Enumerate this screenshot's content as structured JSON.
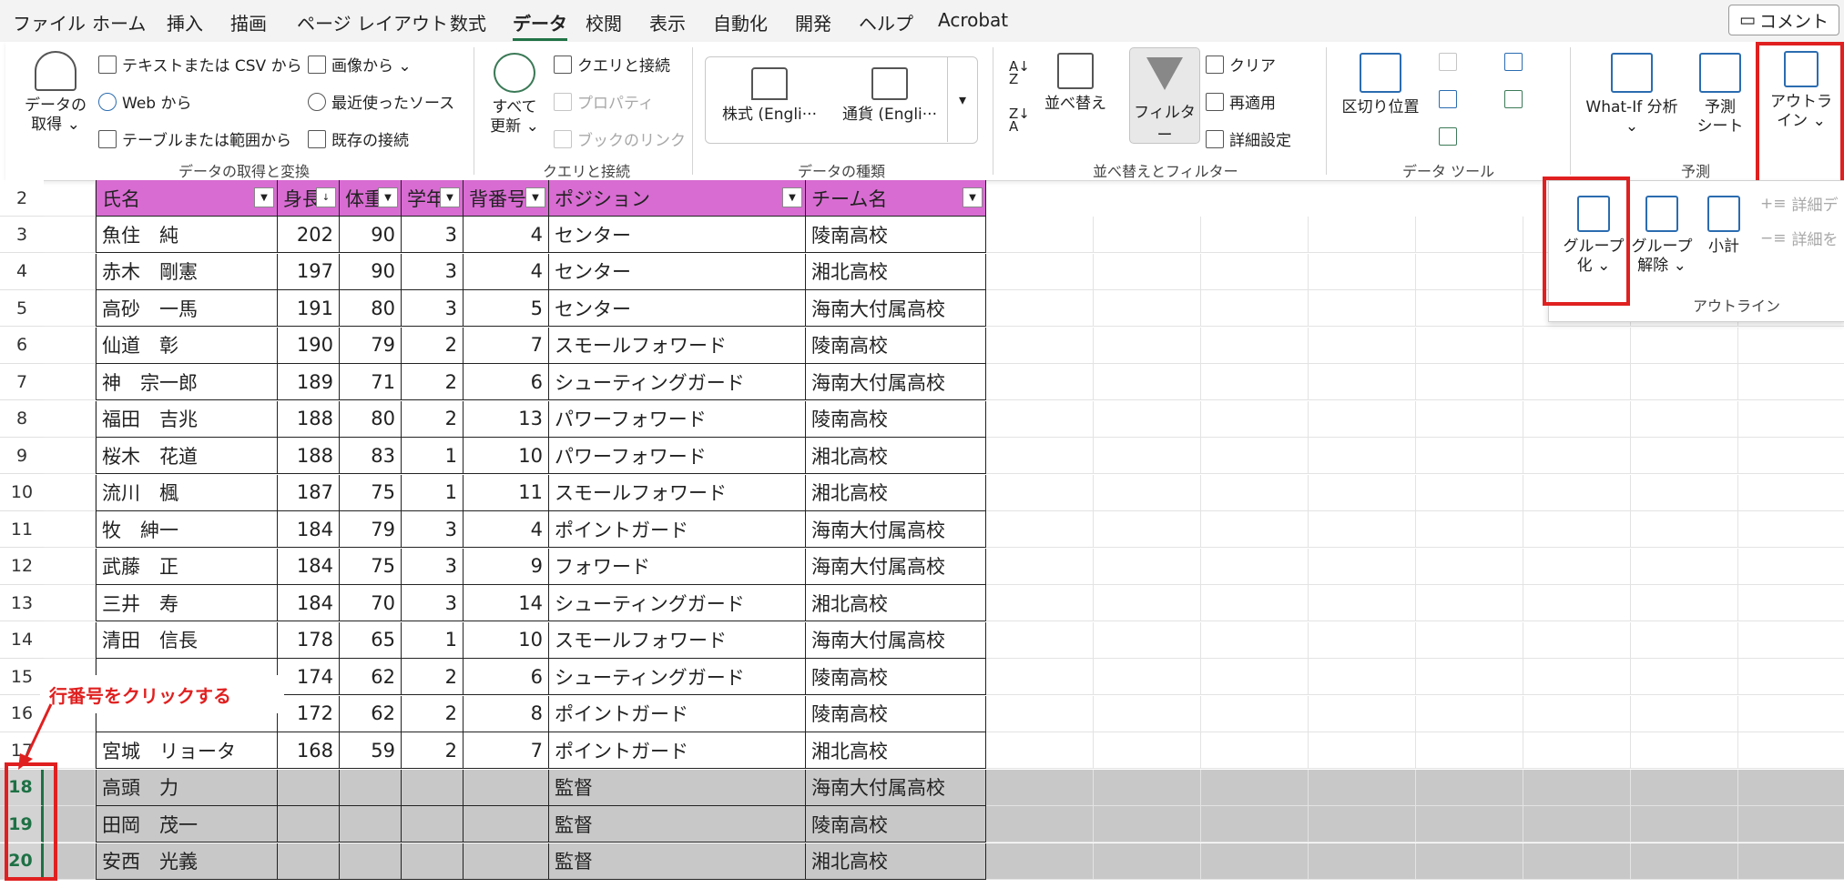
{
  "menu": [
    "ファイル",
    "ホーム",
    "挿入",
    "描画",
    "ページ レイアウト",
    "数式",
    "データ",
    "校閲",
    "表示",
    "自動化",
    "開発",
    "ヘルプ",
    "Acrobat"
  ],
  "comment_label": "コメント",
  "ribbon": {
    "get_data": {
      "big": "データの\n取得 ⌄",
      "items": [
        "テキストまたは CSV から",
        "Web から",
        "テーブルまたは範囲から"
      ],
      "items2": [
        "画像から ⌄",
        "最近使ったソース",
        "既存の接続"
      ],
      "label": "データの取得と変換"
    },
    "query": {
      "big": "すべて\n更新 ⌄",
      "items": [
        "クエリと接続",
        "プロパティ",
        "ブックのリンク"
      ],
      "label": "クエリと接続"
    },
    "types": {
      "stock": "株式 (Engli···",
      "currency": "通貨 (Engli···",
      "label": "データの種類"
    },
    "sort": {
      "sort_label": "並べ替え",
      "filter": "フィルター",
      "clear": "クリア",
      "reapply": "再適用",
      "advanced": "詳細設定",
      "label": "並べ替えとフィルター"
    },
    "tools": {
      "split": "区切り位置",
      "label": "データ ツール"
    },
    "forecast": {
      "whatif": "What-If 分析\n⌄",
      "sheet": "予測\nシート",
      "label": "予測"
    },
    "outline": {
      "big": "アウトラ\nイン ⌄"
    }
  },
  "outline_panel": {
    "group": "グループ\n化 ⌄",
    "ungroup": "グループ\n解除 ⌄",
    "subtotal": "小計",
    "show": "詳細デ",
    "hide": "詳細を",
    "label": "アウトライン"
  },
  "headers": [
    "氏名",
    "身長",
    "体重",
    "学年",
    "背番号",
    "ポジション",
    "チーム名"
  ],
  "rows": [
    {
      "n": "3",
      "name": "魚住　純",
      "h": "202",
      "w": "90",
      "g": "3",
      "no": "4",
      "pos": "センター",
      "team": "陵南高校"
    },
    {
      "n": "4",
      "name": "赤木　剛憲",
      "h": "197",
      "w": "90",
      "g": "3",
      "no": "4",
      "pos": "センター",
      "team": "湘北高校"
    },
    {
      "n": "5",
      "name": "高砂　一馬",
      "h": "191",
      "w": "80",
      "g": "3",
      "no": "5",
      "pos": "センター",
      "team": "海南大付属高校"
    },
    {
      "n": "6",
      "name": "仙道　彰",
      "h": "190",
      "w": "79",
      "g": "2",
      "no": "7",
      "pos": "スモールフォワード",
      "team": "陵南高校"
    },
    {
      "n": "7",
      "name": "神　宗一郎",
      "h": "189",
      "w": "71",
      "g": "2",
      "no": "6",
      "pos": "シューティングガード",
      "team": "海南大付属高校"
    },
    {
      "n": "8",
      "name": "福田　吉兆",
      "h": "188",
      "w": "80",
      "g": "2",
      "no": "13",
      "pos": "パワーフォワード",
      "team": "陵南高校"
    },
    {
      "n": "9",
      "name": "桜木　花道",
      "h": "188",
      "w": "83",
      "g": "1",
      "no": "10",
      "pos": "パワーフォワード",
      "team": "湘北高校"
    },
    {
      "n": "10",
      "name": "流川　楓",
      "h": "187",
      "w": "75",
      "g": "1",
      "no": "11",
      "pos": "スモールフォワード",
      "team": "湘北高校"
    },
    {
      "n": "11",
      "name": "牧　紳一",
      "h": "184",
      "w": "79",
      "g": "3",
      "no": "4",
      "pos": "ポイントガード",
      "team": "海南大付属高校"
    },
    {
      "n": "12",
      "name": "武藤　正",
      "h": "184",
      "w": "75",
      "g": "3",
      "no": "9",
      "pos": "フォワード",
      "team": "海南大付属高校"
    },
    {
      "n": "13",
      "name": "三井　寿",
      "h": "184",
      "w": "70",
      "g": "3",
      "no": "14",
      "pos": "シューティングガード",
      "team": "湘北高校"
    },
    {
      "n": "14",
      "name": "清田　信長",
      "h": "178",
      "w": "65",
      "g": "1",
      "no": "10",
      "pos": "スモールフォワード",
      "team": "海南大付属高校"
    },
    {
      "n": "15",
      "name": "",
      "h": "174",
      "w": "62",
      "g": "2",
      "no": "6",
      "pos": "シューティングガード",
      "team": "陵南高校"
    },
    {
      "n": "16",
      "name": "",
      "h": "172",
      "w": "62",
      "g": "2",
      "no": "8",
      "pos": "ポイントガード",
      "team": "陵南高校"
    },
    {
      "n": "17",
      "name": "宮城　リョータ",
      "h": "168",
      "w": "59",
      "g": "2",
      "no": "7",
      "pos": "ポイントガード",
      "team": "湘北高校"
    },
    {
      "n": "18",
      "name": "高頭　力",
      "h": "",
      "w": "",
      "g": "",
      "no": "",
      "pos": "監督",
      "team": "海南大付属高校"
    },
    {
      "n": "19",
      "name": "田岡　茂一",
      "h": "",
      "w": "",
      "g": "",
      "no": "",
      "pos": "監督",
      "team": "陵南高校"
    },
    {
      "n": "20",
      "name": "安西　光義",
      "h": "",
      "w": "",
      "g": "",
      "no": "",
      "pos": "監督",
      "team": "湘北高校"
    }
  ],
  "callout": "行番号をクリックする",
  "colors": {
    "accent": "#217346",
    "header": "#d86cd2",
    "highlight": "#e02020"
  }
}
